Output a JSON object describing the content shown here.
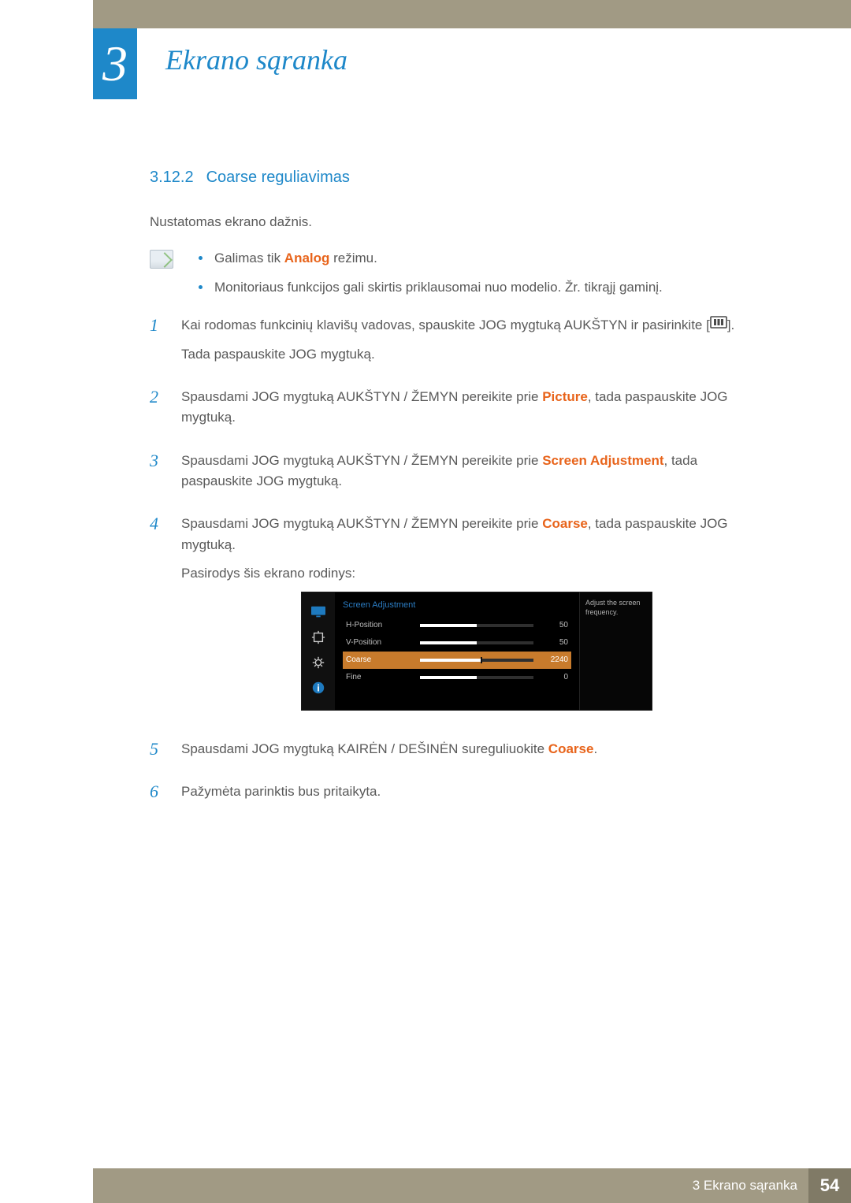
{
  "chapter": {
    "number": "3",
    "title": "Ekrano sąranka"
  },
  "section": {
    "number": "3.12.2",
    "title": "Coarse reguliavimas"
  },
  "intro_text": "Nustatomas ekrano dažnis.",
  "notes": {
    "item1_pre": "Galimas tik ",
    "item1_kw": "Analog",
    "item1_post": " režimu.",
    "item2": "Monitoriaus funkcijos gali skirtis priklausomai nuo modelio. Žr. tikrąjį gaminį."
  },
  "steps": {
    "s1": {
      "num": "1",
      "line1_a": "Kai rodomas funkcinių klavišų vadovas, spauskite JOG mygtuką AUKŠTYN ir pasirinkite [",
      "line1_b": "].",
      "line2": "Tada paspauskite JOG mygtuką."
    },
    "s2": {
      "num": "2",
      "pre": "Spausdami JOG mygtuką AUKŠTYN / ŽEMYN pereikite prie ",
      "kw": "Picture",
      "post": ", tada paspauskite JOG mygtuką."
    },
    "s3": {
      "num": "3",
      "pre": "Spausdami JOG mygtuką AUKŠTYN / ŽEMYN pereikite prie ",
      "kw": "Screen Adjustment",
      "post": ", tada paspauskite JOG mygtuką."
    },
    "s4": {
      "num": "4",
      "pre": "Spausdami JOG mygtuką AUKŠTYN / ŽEMYN pereikite prie ",
      "kw": "Coarse",
      "post": ", tada paspauskite JOG mygtuką.",
      "after": "Pasirodys šis ekrano rodinys:"
    },
    "s5": {
      "num": "5",
      "pre": "Spausdami JOG mygtuką KAIRĖN / DEŠINĖN sureguliuokite ",
      "kw": "Coarse",
      "post": "."
    },
    "s6": {
      "num": "6",
      "text": "Pažymėta parinktis bus pritaikyta."
    }
  },
  "osd": {
    "title": "Screen Adjustment",
    "rows": {
      "hpos": {
        "label": "H-Position",
        "value": "50",
        "fill_pct": 50
      },
      "vpos": {
        "label": "V-Position",
        "value": "50",
        "fill_pct": 50
      },
      "coarse": {
        "label": "Coarse",
        "value": "2240",
        "fill_pct": 55
      },
      "fine": {
        "label": "Fine",
        "value": "0",
        "fill_pct": 50
      }
    },
    "tooltip": "Adjust the screen frequency."
  },
  "footer": {
    "label": "3 Ekrano sąranka",
    "page": "54"
  }
}
